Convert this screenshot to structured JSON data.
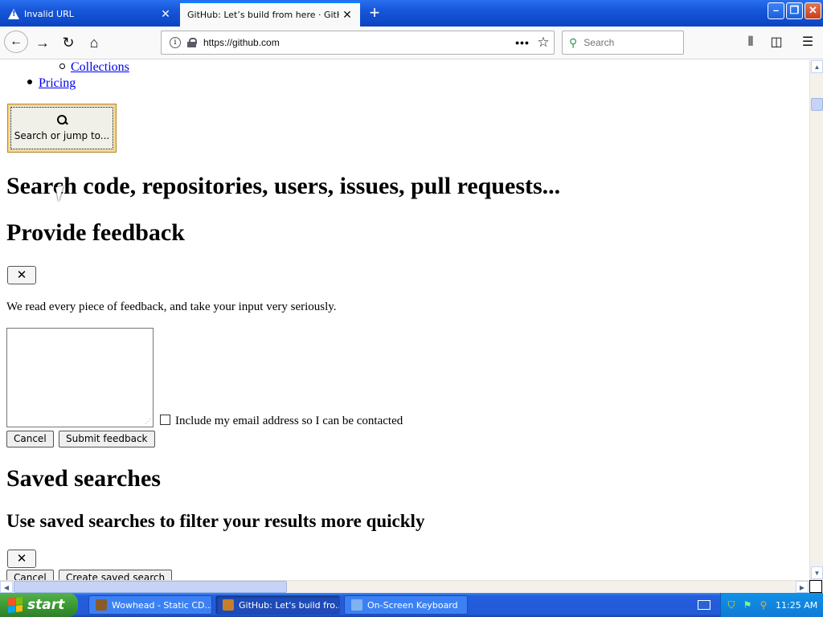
{
  "browser": {
    "tabs": [
      {
        "title": "Invalid URL",
        "active": false
      },
      {
        "title": "GitHub: Let’s build from here · GitHub",
        "active": true
      }
    ],
    "url": "https://github.com",
    "search_placeholder": "Search",
    "window_buttons": {
      "minimize": "–",
      "maximize": "❐",
      "close": "✕"
    }
  },
  "page": {
    "nav_sub_item": "Collections",
    "nav_item": "Pricing",
    "jump_button_label": "Search or jump to...",
    "search_heading": "Search code, repositories, users, issues, pull requests...",
    "feedback_heading": "Provide feedback",
    "close_glyph": "✕",
    "feedback_text": "We read every piece of feedback, and take your input very seriously.",
    "email_checkbox_label": "Include my email address so I can be contacted",
    "cancel_label": "Cancel",
    "submit_feedback_label": "Submit feedback",
    "saved_heading": "Saved searches",
    "saved_subheading": "Use saved searches to filter your results more quickly",
    "create_saved_label": "Create saved search"
  },
  "taskbar": {
    "start_label": "start",
    "tasks": [
      {
        "label": "Wowhead - Static CD...",
        "active": false
      },
      {
        "label": "GitHub: Let's build fro...",
        "active": true
      },
      {
        "label": "On-Screen Keyboard",
        "active": false
      }
    ],
    "clock": "11:25 AM"
  },
  "colors": {
    "link": "#0000ee",
    "xp_blue": "#245edc",
    "start_green": "#3c9b34",
    "focus_accent": "#0a84ff"
  }
}
